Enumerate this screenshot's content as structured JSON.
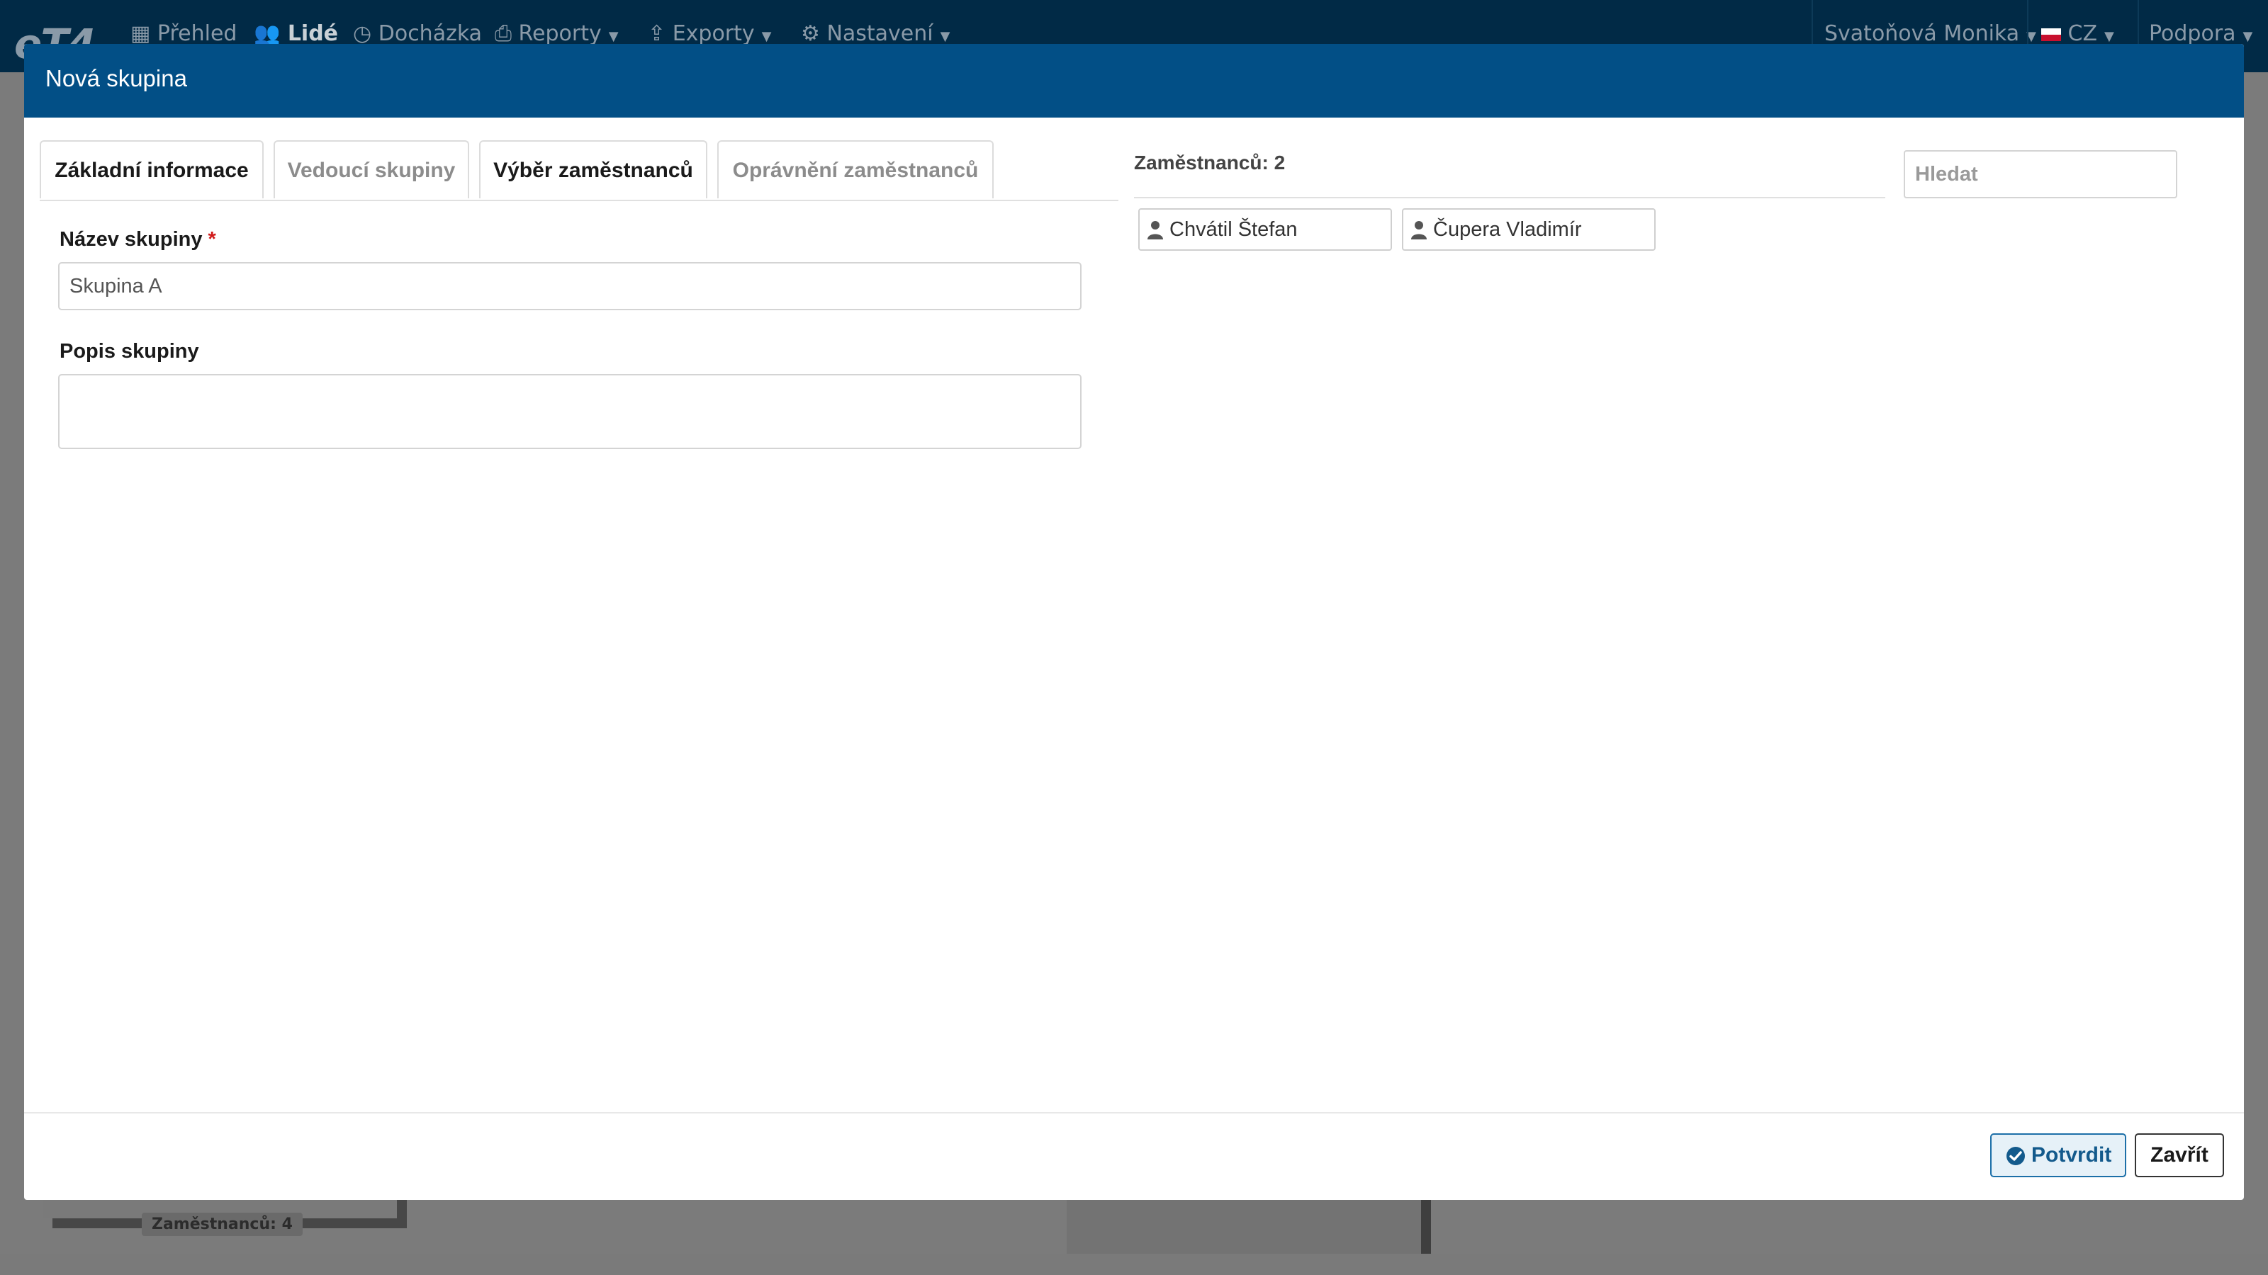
{
  "app": {
    "logo_text": "eT4",
    "nav": [
      {
        "label": "Přehled",
        "icon": "grid-icon",
        "active": false
      },
      {
        "label": "Lidé",
        "icon": "users-icon",
        "active": true
      },
      {
        "label": "Docházka",
        "icon": "clock-icon",
        "active": false
      },
      {
        "label": "Reporty",
        "icon": "printer-icon",
        "active": false
      },
      {
        "label": "Exporty",
        "icon": "export-icon",
        "active": false
      },
      {
        "label": "Nastavení",
        "icon": "gear-icon",
        "active": false
      }
    ],
    "user_name": "Svatoňová Monika",
    "language": "CZ",
    "support_label": "Podpora",
    "background_badge": "Zaměstnanců: 4"
  },
  "modal": {
    "title": "Nová skupina",
    "tabs": [
      {
        "label": "Základní informace",
        "active": true
      },
      {
        "label": "Vedoucí skupiny",
        "active": false
      },
      {
        "label": "Výběr zaměstnanců",
        "active": false
      },
      {
        "label": "Oprávnění zaměstnanců",
        "active": false
      }
    ],
    "name_field": {
      "label": "Název skupiny",
      "required_mark": "*",
      "value": "Skupina A"
    },
    "description_field": {
      "label": "Popis skupiny",
      "value": ""
    },
    "employees": {
      "count_label": "Zaměstnanců: 2",
      "search_placeholder": "Hledat",
      "items": [
        "Chvátil Štefan",
        "Čupera Vladimír"
      ]
    },
    "confirm_label": "Potvrdit",
    "close_label": "Zavřít"
  },
  "colors": {
    "header": "#024f86",
    "topnav": "#012a46",
    "required": "#d01919",
    "confirm_border": "#1c6fa8"
  }
}
